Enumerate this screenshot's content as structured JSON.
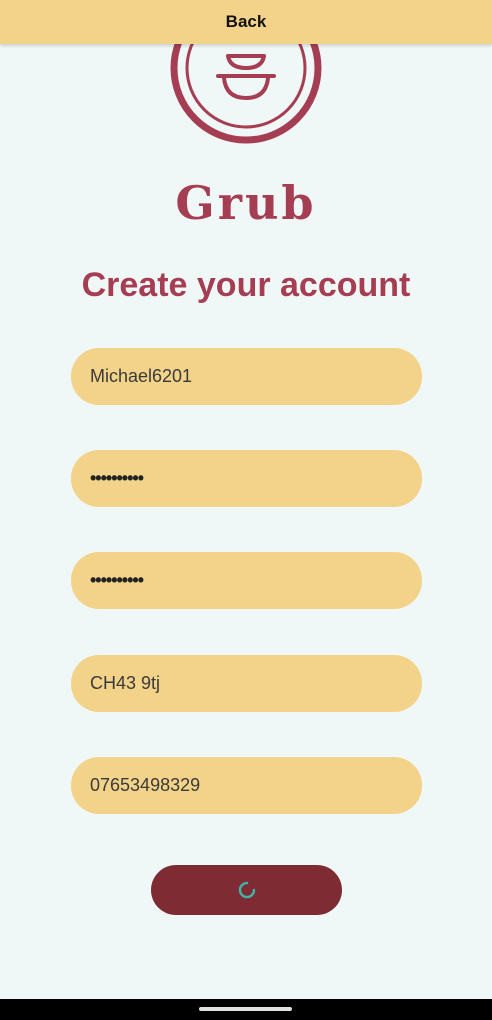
{
  "header": {
    "back_label": "Back"
  },
  "logo": {
    "icon": "bowl-icon"
  },
  "brand": {
    "name": "Grub"
  },
  "form": {
    "title": "Create your account",
    "fields": [
      {
        "value": "Michael6201"
      },
      {
        "value": "••••••••••"
      },
      {
        "value": "••••••••••"
      },
      {
        "value": "CH43 9tj"
      },
      {
        "value": "07653498329"
      }
    ],
    "submit": {
      "state": "loading",
      "icon": "loading-spinner-icon"
    }
  },
  "colors": {
    "accent": "#a63e53",
    "field_bg": "#f2d389",
    "button_bg": "#7e2b33",
    "spinner": "#3fb2a5",
    "background": "#f0f7f7"
  }
}
